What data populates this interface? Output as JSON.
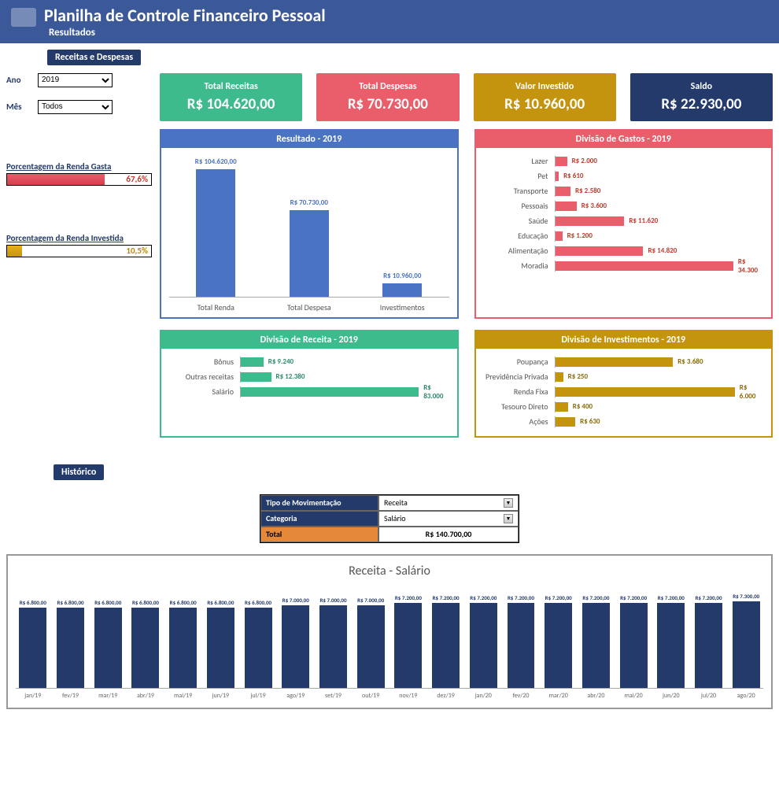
{
  "header": {
    "title": "Planilha de Controle Financeiro Pessoal",
    "subtitle": "Resultados"
  },
  "sections": {
    "receitas_despesas": "Receitas e Despesas",
    "historico": "Histórico"
  },
  "filters": {
    "ano_label": "Ano",
    "ano_value": "2019",
    "mes_label": "Mês",
    "mes_value": "Todos"
  },
  "percent": {
    "gasta": {
      "label": "Porcentagem da Renda Gasta",
      "value": "67,6%",
      "pct": 67.6
    },
    "investida": {
      "label": "Porcentagem da Renda Investida",
      "value": "10,5%",
      "pct": 10.5
    }
  },
  "cards": {
    "receitas": {
      "label": "Total Receitas",
      "value": "R$ 104.620,00"
    },
    "despesas": {
      "label": "Total Despesas",
      "value": "R$ 70.730,00"
    },
    "investido": {
      "label": "Valor Investido",
      "value": "R$ 10.960,00"
    },
    "saldo": {
      "label": "Saldo",
      "value": "R$ 22.930,00"
    }
  },
  "chart_titles": {
    "resultado": "Resultado - 2019",
    "gastos": "Divisão de Gastos - 2019",
    "receita": "Divisão de Receita - 2019",
    "investimentos": "Divisão de Investimentos - 2019"
  },
  "historico": {
    "tipo_label": "Tipo de Movimentação",
    "tipo_value": "Receita",
    "categoria_label": "Categoria",
    "categoria_value": "Salário",
    "total_label": "Total",
    "total_value": "R$ 140.700,00",
    "chart_title": "Receita - Salário"
  },
  "chart_data": [
    {
      "id": "resultado",
      "type": "bar",
      "categories": [
        "Total Renda",
        "Total Despesa",
        "Investimentos"
      ],
      "labels": [
        "R$ 104.620,00",
        "R$ 70.730,00",
        "R$ 10.960,00"
      ],
      "values": [
        104620,
        70730,
        10960
      ],
      "title": "Resultado - 2019",
      "ylim": [
        0,
        110000
      ]
    },
    {
      "id": "gastos",
      "type": "bar",
      "orientation": "horizontal",
      "categories": [
        "Lazer",
        "Pet",
        "Transporte",
        "Pessoais",
        "Saúde",
        "Educação",
        "Alimentação",
        "Moradia"
      ],
      "labels": [
        "R$ 2.000",
        "R$ 610",
        "R$ 2.580",
        "R$ 3.600",
        "R$ 11.620",
        "R$ 1.200",
        "R$ 14.820",
        "R$ 34.300"
      ],
      "values": [
        2000,
        610,
        2580,
        3600,
        11620,
        1200,
        14820,
        34300
      ],
      "title": "Divisão de Gastos - 2019",
      "xlim": [
        0,
        35000
      ]
    },
    {
      "id": "receita",
      "type": "bar",
      "orientation": "horizontal",
      "categories": [
        "Bônus",
        "Outras receitas",
        "Salário"
      ],
      "labels": [
        "R$ 9.240",
        "R$ 12.380",
        "R$ 83.000"
      ],
      "values": [
        9240,
        12380,
        83000
      ],
      "title": "Divisão de Receita - 2019",
      "xlim": [
        0,
        85000
      ]
    },
    {
      "id": "investimentos",
      "type": "bar",
      "orientation": "horizontal",
      "categories": [
        "Poupança",
        "Previdência Privada",
        "Renda Fixa",
        "Tesouro Direto",
        "Ações"
      ],
      "labels": [
        "R$ 3.680",
        "R$ 250",
        "R$ 6.000",
        "R$ 400",
        "R$ 630"
      ],
      "values": [
        3680,
        250,
        6000,
        400,
        630
      ],
      "title": "Divisão de Investimentos - 2019",
      "xlim": [
        0,
        6500
      ]
    },
    {
      "id": "historico",
      "type": "bar",
      "categories": [
        "jan/19",
        "fev/19",
        "mar/19",
        "abr/19",
        "mai/19",
        "jun/19",
        "jul/19",
        "ago/19",
        "set/19",
        "out/19",
        "nov/19",
        "dez/19",
        "jan/20",
        "fev/20",
        "mar/20",
        "abr/20",
        "mai/20",
        "jun/20",
        "jul/20",
        "ago/20"
      ],
      "labels": [
        "R$ 6.800,00",
        "R$ 6.800,00",
        "R$ 6.800,00",
        "R$ 6.800,00",
        "R$ 6.800,00",
        "R$ 6.800,00",
        "R$ 6.800,00",
        "R$ 7.000,00",
        "R$ 7.000,00",
        "R$ 7.000,00",
        "R$ 7.200,00",
        "R$ 7.200,00",
        "R$ 7.200,00",
        "R$ 7.200,00",
        "R$ 7.200,00",
        "R$ 7.200,00",
        "R$ 7.200,00",
        "R$ 7.200,00",
        "R$ 7.200,00",
        "R$ 7.300,00"
      ],
      "values": [
        6800,
        6800,
        6800,
        6800,
        6800,
        6800,
        6800,
        7000,
        7000,
        7000,
        7200,
        7200,
        7200,
        7200,
        7200,
        7200,
        7200,
        7200,
        7200,
        7300
      ],
      "title": "Receita - Salário",
      "ylim": [
        0,
        8000
      ]
    }
  ]
}
